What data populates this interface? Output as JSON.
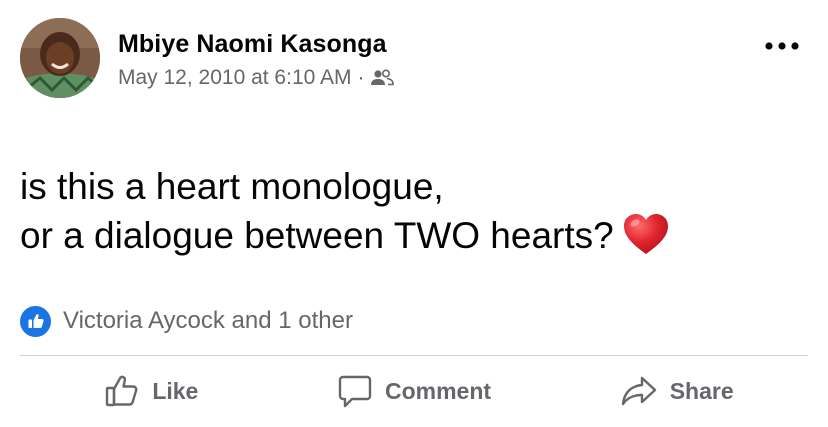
{
  "post": {
    "author": "Mbiye Naomi Kasonga",
    "timestamp": "May 12, 2010 at 6:10 AM",
    "separator": "·",
    "audience_icon": "friends-icon",
    "text_lines": [
      "is this a heart monologue,",
      "or a dialogue between TWO hearts?"
    ],
    "emoji": "red-heart-icon"
  },
  "reactions": {
    "icon": "like-icon",
    "summary": "Victoria Aycock and 1 other"
  },
  "actions": {
    "like_label": "Like",
    "comment_label": "Comment",
    "share_label": "Share"
  },
  "colors": {
    "text_primary": "#050505",
    "text_secondary": "#65676b",
    "like_blue": "#1b74e4",
    "heart_red": "#e0242c",
    "divider": "#ced0d4"
  }
}
